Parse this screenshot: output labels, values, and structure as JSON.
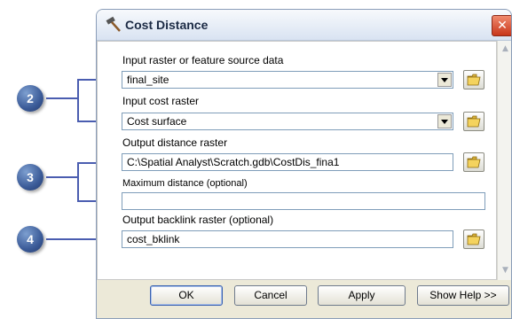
{
  "dialog": {
    "title": "Cost Distance",
    "close_glyph": "✕",
    "title_icon": "hammer-icon"
  },
  "fields": {
    "input_raster": {
      "label": "Input raster or feature source data",
      "value": "final_site"
    },
    "cost_raster": {
      "label": "Input cost raster",
      "value": "Cost surface"
    },
    "output_distance": {
      "label": "Output distance raster",
      "value": "C:\\Spatial  Analyst\\Scratch.gdb\\CostDis_fina1"
    },
    "max_distance": {
      "label": "Maximum distance (optional)",
      "value": ""
    },
    "backlink": {
      "label": "Output backlink raster (optional)",
      "value": "cost_bklink"
    }
  },
  "buttons": {
    "ok": "OK",
    "cancel": "Cancel",
    "apply": "Apply",
    "show_help": "Show Help >>"
  },
  "callouts": {
    "c2": "2",
    "c3": "3",
    "c4": "4"
  },
  "icons": {
    "folder": "open-folder-icon",
    "scroll_up": "▲",
    "scroll_down": "▼"
  },
  "colors": {
    "callout": "#3b5b98",
    "leader_line": "#4a5db0",
    "close": "#c8361a"
  }
}
